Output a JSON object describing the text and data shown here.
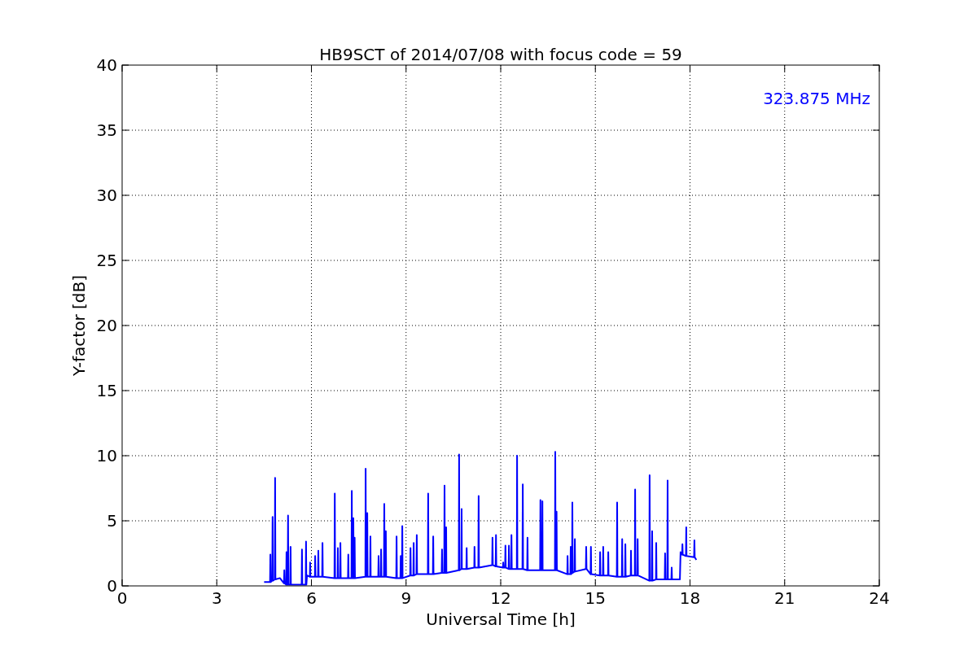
{
  "plot": {
    "chart_data": {
      "type": "line",
      "title": "HB9SCT of 2014/07/08 with focus code = 59",
      "xlabel": "Universal Time [h]",
      "ylabel": "Y-factor [dB]",
      "xlim": [
        0,
        24
      ],
      "ylim": [
        0,
        40
      ],
      "xticks": [
        0,
        3,
        6,
        9,
        12,
        15,
        18,
        21,
        24
      ],
      "yticks": [
        0,
        5,
        10,
        15,
        20,
        25,
        30,
        35,
        40
      ],
      "grid": true,
      "x": [
        4.5,
        4.69,
        4.7,
        4.71,
        4.76,
        4.77,
        4.78,
        4.84,
        4.85,
        4.86,
        5.0,
        5.13,
        5.14,
        5.15,
        5.2,
        5.21,
        5.22,
        5.25,
        5.26,
        5.27,
        5.33,
        5.34,
        5.35,
        5.69,
        5.7,
        5.71,
        5.82,
        5.83,
        5.84,
        5.86,
        5.95,
        5.96,
        5.97,
        6.11,
        6.12,
        6.13,
        6.21,
        6.22,
        6.23,
        6.34,
        6.35,
        6.36,
        6.73,
        6.74,
        6.75,
        6.83,
        6.84,
        6.85,
        6.91,
        6.92,
        6.93,
        7.16,
        7.17,
        7.18,
        7.27,
        7.28,
        7.29,
        7.32,
        7.33,
        7.34,
        7.36,
        7.37,
        7.38,
        7.71,
        7.72,
        7.73,
        7.76,
        7.77,
        7.78,
        7.86,
        7.87,
        7.88,
        8.12,
        8.13,
        8.14,
        8.2,
        8.21,
        8.22,
        8.3,
        8.31,
        8.32,
        8.35,
        8.36,
        8.37,
        8.69,
        8.7,
        8.71,
        8.82,
        8.83,
        8.84,
        8.87,
        8.88,
        8.89,
        9.13,
        9.14,
        9.15,
        9.23,
        9.24,
        9.25,
        9.33,
        9.34,
        9.35,
        9.69,
        9.7,
        9.71,
        9.85,
        9.86,
        9.87,
        10.13,
        10.14,
        10.15,
        10.21,
        10.22,
        10.23,
        10.26,
        10.27,
        10.28,
        10.67,
        10.68,
        10.69,
        10.75,
        10.76,
        10.77,
        10.91,
        10.92,
        10.93,
        11.16,
        11.17,
        11.18,
        11.29,
        11.3,
        11.31,
        11.73,
        11.74,
        11.75,
        11.84,
        11.85,
        11.86,
        12.07,
        12.08,
        12.09,
        12.14,
        12.15,
        12.16,
        12.25,
        12.26,
        12.27,
        12.33,
        12.34,
        12.35,
        12.51,
        12.52,
        12.53,
        12.69,
        12.7,
        12.71,
        12.84,
        12.85,
        12.86,
        13.25,
        13.26,
        13.27,
        13.31,
        13.32,
        13.33,
        13.72,
        13.73,
        13.74,
        13.76,
        13.77,
        13.78,
        14.11,
        14.12,
        14.13,
        14.21,
        14.22,
        14.23,
        14.26,
        14.27,
        14.28,
        14.34,
        14.35,
        14.36,
        14.7,
        14.71,
        14.72,
        14.85,
        14.86,
        14.87,
        15.14,
        15.15,
        15.16,
        15.24,
        15.25,
        15.26,
        15.4,
        15.41,
        15.42,
        15.68,
        15.69,
        15.7,
        15.84,
        15.85,
        15.86,
        15.94,
        15.95,
        15.96,
        16.12,
        16.13,
        16.14,
        16.25,
        16.26,
        16.27,
        16.33,
        16.34,
        16.35,
        16.71,
        16.72,
        16.73,
        16.79,
        16.8,
        16.81,
        16.92,
        16.93,
        16.94,
        17.2,
        17.21,
        17.22,
        17.28,
        17.29,
        17.3,
        17.41,
        17.42,
        17.43,
        17.68,
        17.7,
        17.75,
        17.76,
        17.77,
        17.87,
        17.88,
        17.89,
        18.13,
        18.14,
        18.15,
        18.2
      ],
      "series": [
        {
          "name": "323.875 MHz",
          "color": "#0000ff",
          "values": [
            0.3,
            0.3,
            2.4,
            0.3,
            0.4,
            5.3,
            0.4,
            0.5,
            8.3,
            0.5,
            0.6,
            0.2,
            1.2,
            0.2,
            0.1,
            2.6,
            0.1,
            0.1,
            5.4,
            0.1,
            0.1,
            3.0,
            0.1,
            0.1,
            2.8,
            0.1,
            0.1,
            3.4,
            0.1,
            0.8,
            0.7,
            1.8,
            0.7,
            0.7,
            2.3,
            0.7,
            0.7,
            2.7,
            0.7,
            0.7,
            3.3,
            0.7,
            0.6,
            7.1,
            0.6,
            0.6,
            2.9,
            0.6,
            0.6,
            3.3,
            0.6,
            0.6,
            2.4,
            0.6,
            0.6,
            7.3,
            0.6,
            0.6,
            5.2,
            0.6,
            0.6,
            3.7,
            0.6,
            0.7,
            9.0,
            0.7,
            0.7,
            5.6,
            0.7,
            0.7,
            3.8,
            0.7,
            0.7,
            2.3,
            0.7,
            0.7,
            2.8,
            0.7,
            0.7,
            6.3,
            0.7,
            0.7,
            4.2,
            0.7,
            0.6,
            3.8,
            0.6,
            0.6,
            2.3,
            0.6,
            0.6,
            4.6,
            0.6,
            0.8,
            2.9,
            0.8,
            0.8,
            3.3,
            0.8,
            0.9,
            3.9,
            0.9,
            0.9,
            7.1,
            0.9,
            0.9,
            3.8,
            0.9,
            1.0,
            2.8,
            1.0,
            1.0,
            7.7,
            1.0,
            1.0,
            4.5,
            1.0,
            1.2,
            10.1,
            1.2,
            1.3,
            5.9,
            1.3,
            1.3,
            2.9,
            1.3,
            1.4,
            3.0,
            1.4,
            1.4,
            6.9,
            1.4,
            1.6,
            3.7,
            1.6,
            1.5,
            3.9,
            1.5,
            1.4,
            1.8,
            1.4,
            1.4,
            3.1,
            1.4,
            1.3,
            3.1,
            1.3,
            1.3,
            3.9,
            1.3,
            1.3,
            10.0,
            1.3,
            1.3,
            7.8,
            1.3,
            1.2,
            3.7,
            1.2,
            1.2,
            6.6,
            1.2,
            1.2,
            6.5,
            1.2,
            1.2,
            10.3,
            1.2,
            1.2,
            5.7,
            1.2,
            0.9,
            2.3,
            0.9,
            0.9,
            3.0,
            0.9,
            1.0,
            6.4,
            1.0,
            1.1,
            3.6,
            1.1,
            1.3,
            3.0,
            1.3,
            0.9,
            3.0,
            0.9,
            0.8,
            2.6,
            0.8,
            0.8,
            3.0,
            0.8,
            0.8,
            2.6,
            0.8,
            0.7,
            6.4,
            0.7,
            0.7,
            3.6,
            0.7,
            0.7,
            3.2,
            0.7,
            0.8,
            2.7,
            0.8,
            0.8,
            7.4,
            0.8,
            0.8,
            3.6,
            0.8,
            0.4,
            8.5,
            0.4,
            0.4,
            4.2,
            0.4,
            0.5,
            3.3,
            0.5,
            0.5,
            2.5,
            0.5,
            0.5,
            8.1,
            0.5,
            0.5,
            1.4,
            0.5,
            0.5,
            2.6,
            2.4,
            3.2,
            2.4,
            2.3,
            4.5,
            2.3,
            2.2,
            3.5,
            2.2,
            2.0
          ]
        }
      ]
    }
  }
}
